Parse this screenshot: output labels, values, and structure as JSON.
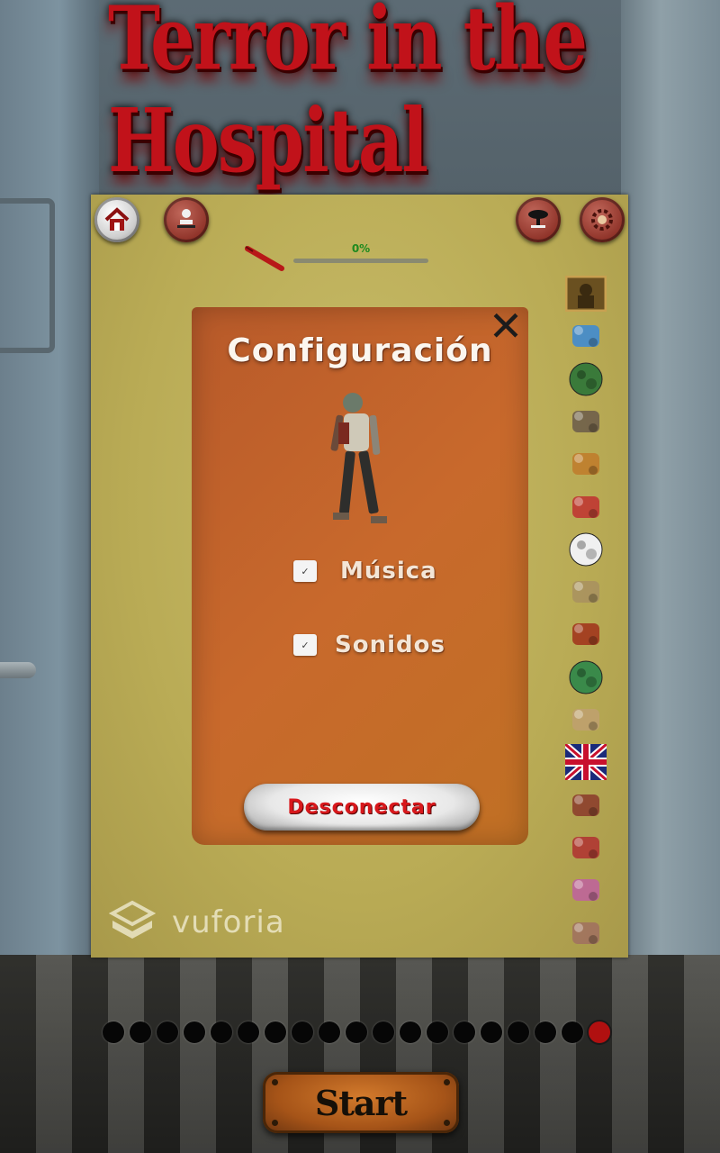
{
  "app": {
    "title": "Terror in the Hospital"
  },
  "toolbar": {
    "home_icon": "home-icon",
    "character_icon": "character-icon",
    "stool_icon": "stool-icon",
    "settings_icon": "gear-icon"
  },
  "progress": {
    "label": "0%",
    "value": 0
  },
  "side_icons": [
    "painting-icon",
    "map-pin-icon",
    "globe-icon",
    "rocks-icon",
    "tools-icon",
    "question-lamp-icon",
    "soccer-ball-icon",
    "sword-icon",
    "helmet-icon",
    "earth-icon",
    "book-icon",
    "uk-flag-icon",
    "fighter-icon",
    "target-icon",
    "music-notes-icon",
    "console-icon"
  ],
  "dialog": {
    "title": "Configuración",
    "options": [
      {
        "label": "Música",
        "checked": true
      },
      {
        "label": "Sonidos",
        "checked": true
      }
    ],
    "disconnect_label": "Desconectar"
  },
  "watermark": {
    "text": "vuforia"
  },
  "pager": {
    "total": 19,
    "active_index": 18
  },
  "start": {
    "label": "Start"
  },
  "colors": {
    "title_red": "#c1121a",
    "panel_yellow": "#b9ab55",
    "dialog_orange": "#c8692c",
    "disconnect_text": "#d8181c",
    "progress_green": "#1e8a1e",
    "active_dot": "#b01010"
  }
}
